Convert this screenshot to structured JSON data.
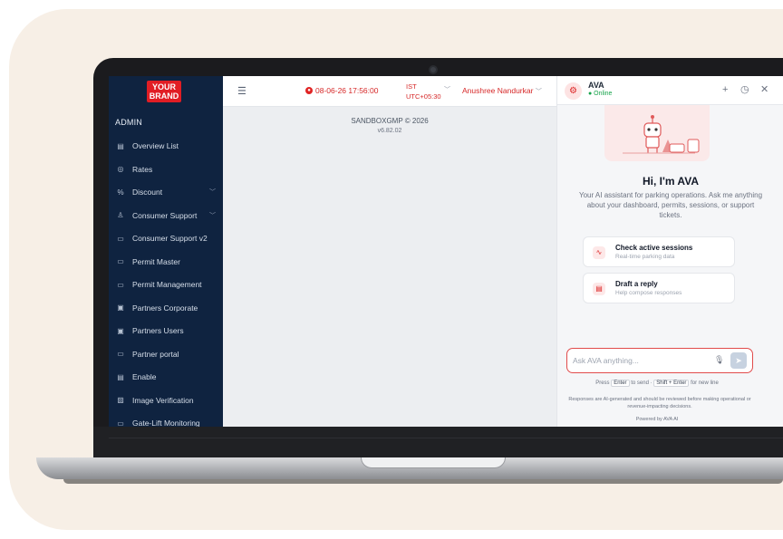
{
  "brand": {
    "logo_line1": "YOUR",
    "logo_line2": "BRAND",
    "accent": "#e11d24"
  },
  "sidebar": {
    "section": "ADMIN",
    "items": [
      {
        "label": "Overview List",
        "icon": "list-icon",
        "glyph": "▤",
        "expandable": false
      },
      {
        "label": "Rates",
        "icon": "tag-icon",
        "glyph": "◎",
        "expandable": false
      },
      {
        "label": "Discount",
        "icon": "discount-icon",
        "glyph": "%",
        "expandable": true
      },
      {
        "label": "Consumer Support",
        "icon": "user-icon",
        "glyph": "♙",
        "expandable": true
      },
      {
        "label": "Consumer Support v2",
        "icon": "card-icon",
        "glyph": "▭",
        "expandable": false
      },
      {
        "label": "Permit Master",
        "icon": "card-icon",
        "glyph": "▭",
        "expandable": false
      },
      {
        "label": "Permit Management",
        "icon": "card-icon",
        "glyph": "▭",
        "expandable": false
      },
      {
        "label": "Partners Corporate",
        "icon": "building-icon",
        "glyph": "▣",
        "expandable": false
      },
      {
        "label": "Partners Users",
        "icon": "users-icon",
        "glyph": "▣",
        "expandable": false
      },
      {
        "label": "Partner portal",
        "icon": "card-icon",
        "glyph": "▭",
        "expandable": false
      },
      {
        "label": "Enable",
        "icon": "toggle-icon",
        "glyph": "▤",
        "expandable": false
      },
      {
        "label": "Image Verification",
        "icon": "image-icon",
        "glyph": "▨",
        "expandable": false
      },
      {
        "label": "Gate-Lift Monitoring",
        "icon": "monitor-icon",
        "glyph": "▭",
        "expandable": false
      }
    ]
  },
  "topbar": {
    "datetime": "08-06-26 17:56:00",
    "tz_line1": "IST",
    "tz_line2": "UTC+05:30",
    "user": "Anushree Nandurkar",
    "alert_color": "#d62828"
  },
  "main": {
    "footer_line1": "SANDBOXGMP © 2026",
    "footer_line2": "v6.82.02"
  },
  "ava": {
    "name": "AVA",
    "status": "● Online",
    "greeting": "Hi, I'm AVA",
    "intro": "Your AI assistant for parking operations. Ask me anything about your dashboard, permits, sessions, or support tickets.",
    "actions": [
      {
        "title": "Check active sessions",
        "subtitle": "Real-time parking data",
        "icon": "pulse-icon"
      },
      {
        "title": "Draft a reply",
        "subtitle": "Help compose responses",
        "icon": "document-icon"
      }
    ],
    "input_placeholder": "Ask AVA anything...",
    "hint_press": "Press",
    "hint_enter": "Enter",
    "hint_to_send": "to send ·",
    "hint_shift": "Shift + Enter",
    "hint_newline": "for new line",
    "disclaimer": "Responses are AI-generated and should be reviewed before making operational or revenue-impacting decisions.",
    "powered": "Powered by AVA AI"
  }
}
